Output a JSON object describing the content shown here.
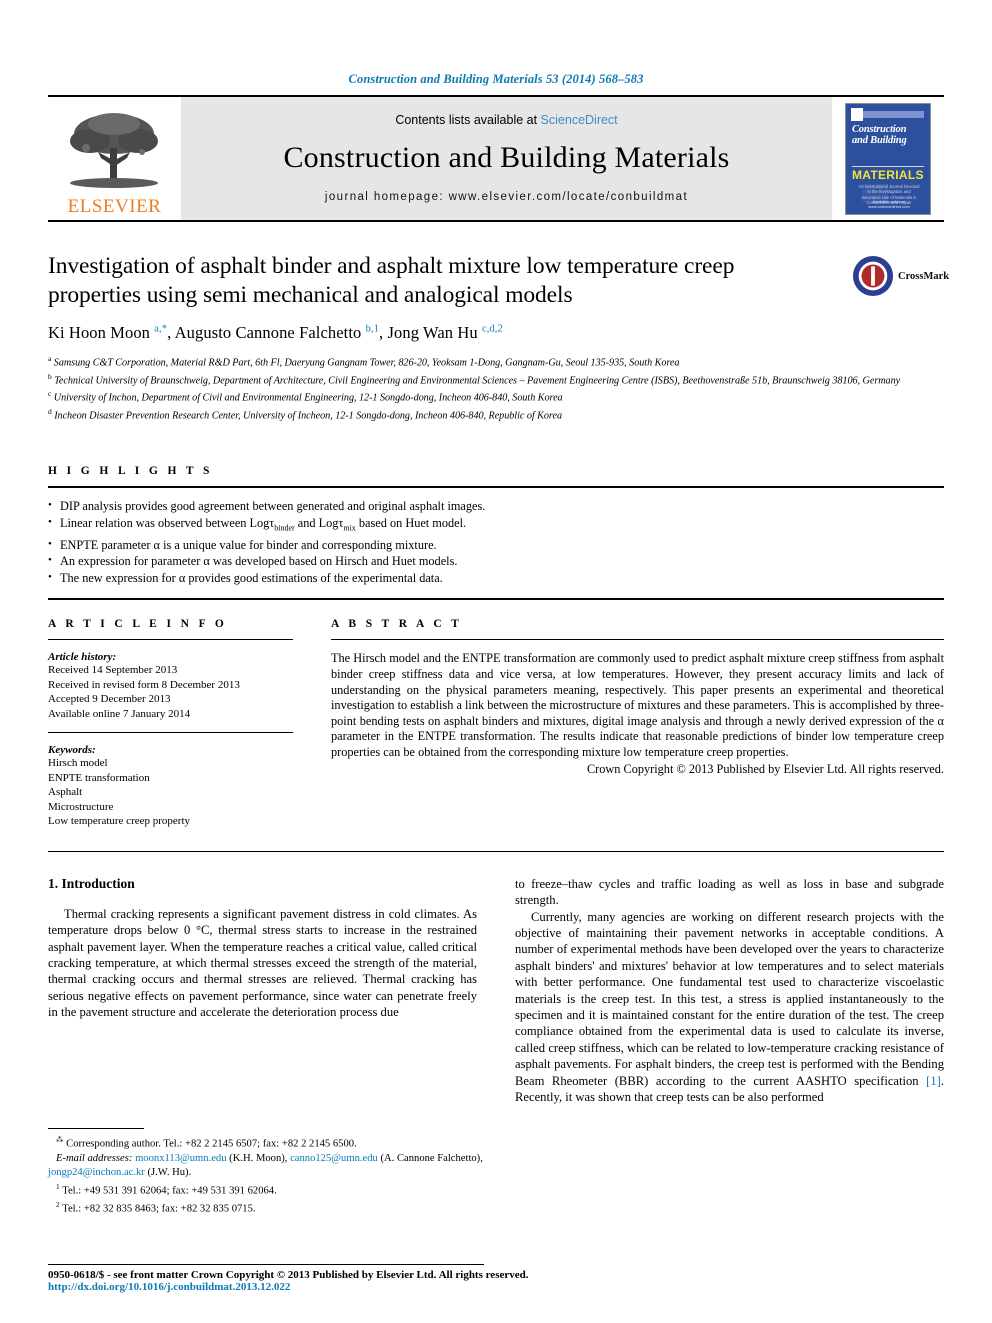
{
  "running_head": "Construction and Building Materials 53 (2014) 568–583",
  "masthead": {
    "publisher_name": "ELSEVIER",
    "contents_prefix": "Contents lists available at ",
    "contents_link": "ScienceDirect",
    "journal_title": "Construction and Building Materials",
    "homepage": "journal homepage: www.elsevier.com/locate/conbuildmat",
    "cover": {
      "line1": "Construction",
      "line2": "and Building",
      "line3": "MATERIALS",
      "blurb": "An International Journal Devoted to the Investigation and Innovative Use of Materials in Construction and Repair",
      "footer": "Available online at www.sciencedirect.com"
    }
  },
  "article": {
    "title": "Investigation of asphalt binder and asphalt mixture low temperature creep properties using semi mechanical and analogical models",
    "crossmark_label": "CrossMark",
    "authors_html": "Ki Hoon Moon <sup>a,*</sup>, Augusto Cannone Falchetto <sup>b,1</sup>, Jong Wan Hu <sup>c,d,2</sup>",
    "affiliations": [
      "<sup>a</sup> Samsung C&amp;T Corporation, Material R&amp;D Part, 6th Fl, Daeryung Gangnam Tower, 826-20, Yeoksam 1-Dong, Gangnam-Gu, Seoul 135-935, South Korea",
      "<sup>b</sup> Technical University of Braunschweig, Department of Architecture, Civil Engineering and Environmental Sciences – Pavement Engineering Centre (ISBS), Beethovenstraße 51b, Braunschweig 38106, Germany",
      "<sup>c</sup> University of Inchon, Department of Civil and Environmental Engineering, 12-1 Songdo-dong, Incheon 406-840, South Korea",
      "<sup>d</sup> Incheon Disaster Prevention Research Center, University of Incheon, 12-1 Songdo-dong, Incheon 406-840, Republic of Korea"
    ]
  },
  "highlights": {
    "label": "H I G H L I G H T S",
    "items": [
      "DIP analysis provides good agreement between generated and original asphalt images.",
      "Linear relation was observed between Log&tau;<sub>binder</sub> and Log&tau;<sub>mix</sub> based on Huet model.",
      "ENPTE parameter &alpha; is a unique value for binder and corresponding mixture.",
      "An expression for parameter &alpha; was developed based on Hirsch and Huet models.",
      "The new expression for &alpha; provides good estimations of the experimental data."
    ]
  },
  "article_info": {
    "label": "A R T I C L E   I N F O",
    "history_title": "Article history:",
    "history": [
      "Received 14 September 2013",
      "Received in revised form 8 December 2013",
      "Accepted 9 December 2013",
      "Available online 7 January 2014"
    ],
    "keywords_title": "Keywords:",
    "keywords": [
      "Hirsch model",
      "ENPTE transformation",
      "Asphalt",
      "Microstructure",
      "Low temperature creep property"
    ]
  },
  "abstract": {
    "label": "A B S T R A C T",
    "text": "The Hirsch model and the ENTPE transformation are commonly used to predict asphalt mixture creep stiffness from asphalt binder creep stiffness data and vice versa, at low temperatures. However, they present accuracy limits and lack of understanding on the physical parameters meaning, respectively. This paper presents an experimental and theoretical investigation to establish a link between the microstructure of mixtures and these parameters. This is accomplished by three-point bending tests on asphalt binders and mixtures, digital image analysis and through a newly derived expression of the α parameter in the ENTPE transformation. The results indicate that reasonable predictions of binder low temperature creep properties can be obtained from the corresponding mixture low temperature creep properties.",
    "copyright": "Crown Copyright © 2013 Published by Elsevier Ltd. All rights reserved."
  },
  "body": {
    "section_title": "1. Introduction",
    "col1_para1": "Thermal cracking represents a significant pavement distress in cold climates. As temperature drops below 0 °C, thermal stress starts to increase in the restrained asphalt pavement layer. When the temperature reaches a critical value, called critical cracking temperature, at which thermal stresses exceed the strength of the material, thermal cracking occurs and thermal stresses are relieved. Thermal cracking has serious negative effects on pavement performance, since water can penetrate freely in the pavement structure and accelerate the deterioration process due",
    "col2_para1_cont": "to freeze–thaw cycles and traffic loading as well as loss in base and subgrade strength.",
    "col2_para2_html": "Currently, many agencies are working on different research projects with the objective of maintaining their pavement networks in acceptable conditions. A number of experimental methods have been developed over the years to characterize asphalt binders' and mixtures' behavior at low temperatures and to select materials with better performance. One fundamental test used to characterize viscoelastic materials is the creep test. In this test, a stress is applied instantaneously to the specimen and it is maintained constant for the entire duration of the test. The creep compliance obtained from the experimental data is used to calculate its inverse, called creep stiffness, which can be related to low-temperature cracking resistance of asphalt pavements. For asphalt binders, the creep test is performed with the Bending Beam Rheometer (BBR) according to the current AASHTO specification <span class=\"cite\">[1]</span>. Recently, it was shown that creep tests can be also performed"
  },
  "footnotes": {
    "corresponding_html": "<sup>&#8258;</sup> Corresponding author. Tel.: +82 2 2145 6507; fax: +82 2 2145 6500.",
    "email_html": "<i>E-mail addresses:</i> <span class=\"mail\">moonx113@umn.edu</span> (K.H. Moon), <span class=\"mail\">canno125@umn.edu</span> (A. Cannone Falchetto), <span class=\"mail\">jongp24@inchon.ac.kr</span> (J.W. Hu).",
    "note1_html": "<sup>1</sup> Tel.: +49 531 391 62064; fax: +49 531 391 62064.",
    "note2_html": "<sup>2</sup> Tel.: +82 32 835 8463; fax: +82 32 835 0715."
  },
  "page_footer": {
    "issn": "0950-0618/$ - see front matter Crown Copyright © 2013 Published by Elsevier Ltd. All rights reserved.",
    "doi": "http://dx.doi.org/10.1016/j.conbuildmat.2013.12.022"
  },
  "colors": {
    "link_blue": "#0b7ab5",
    "elsevier_orange": "#ef7d22",
    "cover_blue": "#2c4f9e",
    "masthead_grey": "#e6e6e6"
  }
}
